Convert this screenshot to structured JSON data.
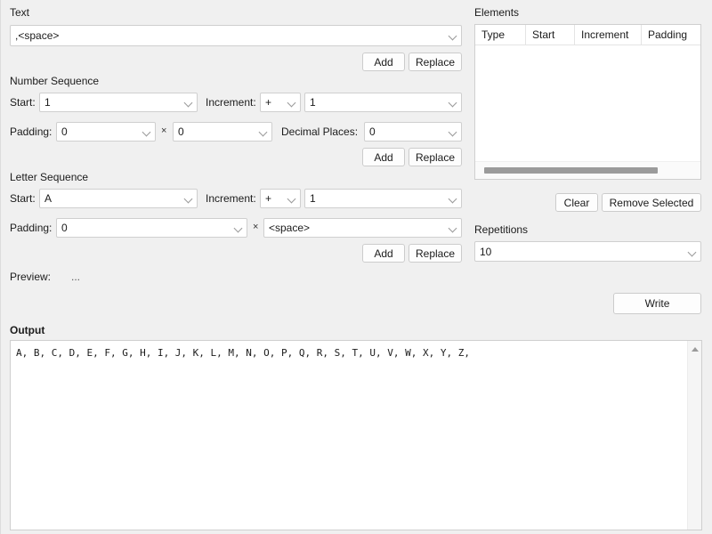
{
  "text_section": {
    "title": "Text",
    "value": ",<space>",
    "add_label": "Add",
    "replace_label": "Replace"
  },
  "number_sequence": {
    "title": "Number Sequence",
    "start_label": "Start:",
    "start_value": "1",
    "increment_label": "Increment:",
    "increment_op": "+",
    "increment_value": "1",
    "padding_label": "Padding:",
    "padding_value": "0",
    "multiply_symbol": "×",
    "padding_char": "0",
    "decimal_label": "Decimal Places:",
    "decimal_value": "0",
    "add_label": "Add",
    "replace_label": "Replace"
  },
  "letter_sequence": {
    "title": "Letter Sequence",
    "start_label": "Start:",
    "start_value": "A",
    "increment_label": "Increment:",
    "increment_op": "+",
    "increment_value": "1",
    "padding_label": "Padding:",
    "padding_value": "0",
    "multiply_symbol": "×",
    "padding_char": "<space>",
    "add_label": "Add",
    "replace_label": "Replace"
  },
  "preview": {
    "label": "Preview:",
    "value": "..."
  },
  "elements": {
    "title": "Elements",
    "columns": [
      "Type",
      "Start",
      "Increment",
      "Padding"
    ],
    "rows": [],
    "clear_label": "Clear",
    "remove_label": "Remove Selected"
  },
  "repetitions": {
    "title": "Repetitions",
    "value": "10"
  },
  "write": {
    "label": "Write"
  },
  "output": {
    "title": "Output",
    "text": "A, B, C, D, E, F, G, H, I, J, K, L, M, N, O, P, Q, R, S, T, U, V, W, X, Y, Z,"
  },
  "icons": {
    "chevron_down": "chevron-down-icon",
    "scroll_up_arrow": "scroll-up-arrow-icon"
  }
}
